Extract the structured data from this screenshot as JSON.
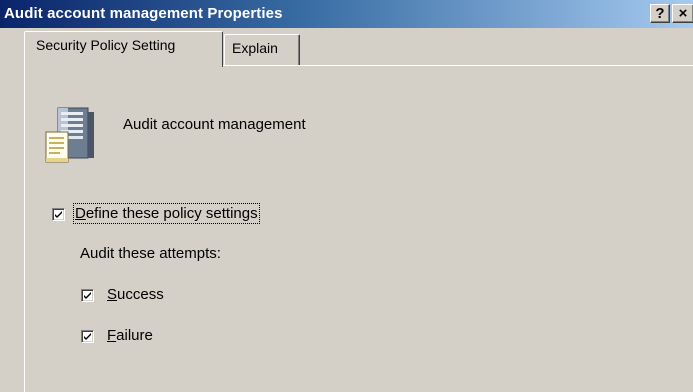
{
  "window": {
    "title": "Audit account management Properties",
    "help_button": "?",
    "close_button": "×"
  },
  "tabs": [
    {
      "label": "Security Policy Setting",
      "active": true
    },
    {
      "label": "Explain",
      "active": false
    }
  ],
  "policy": {
    "icon": "server-policy-icon",
    "name": "Audit account management"
  },
  "define_checkbox": {
    "label_first": "D",
    "label_rest": "efine these policy settings",
    "checked": true
  },
  "audit_section": {
    "label": "Audit these attempts:"
  },
  "success_checkbox": {
    "label_first": "S",
    "label_rest": "uccess",
    "checked": true
  },
  "failure_checkbox": {
    "label_first": "F",
    "label_rest": "ailure",
    "checked": true
  },
  "colors": {
    "titlebar_start": "#0a246a",
    "titlebar_end": "#a6caf0",
    "dialog_face": "#d4d0c8"
  }
}
